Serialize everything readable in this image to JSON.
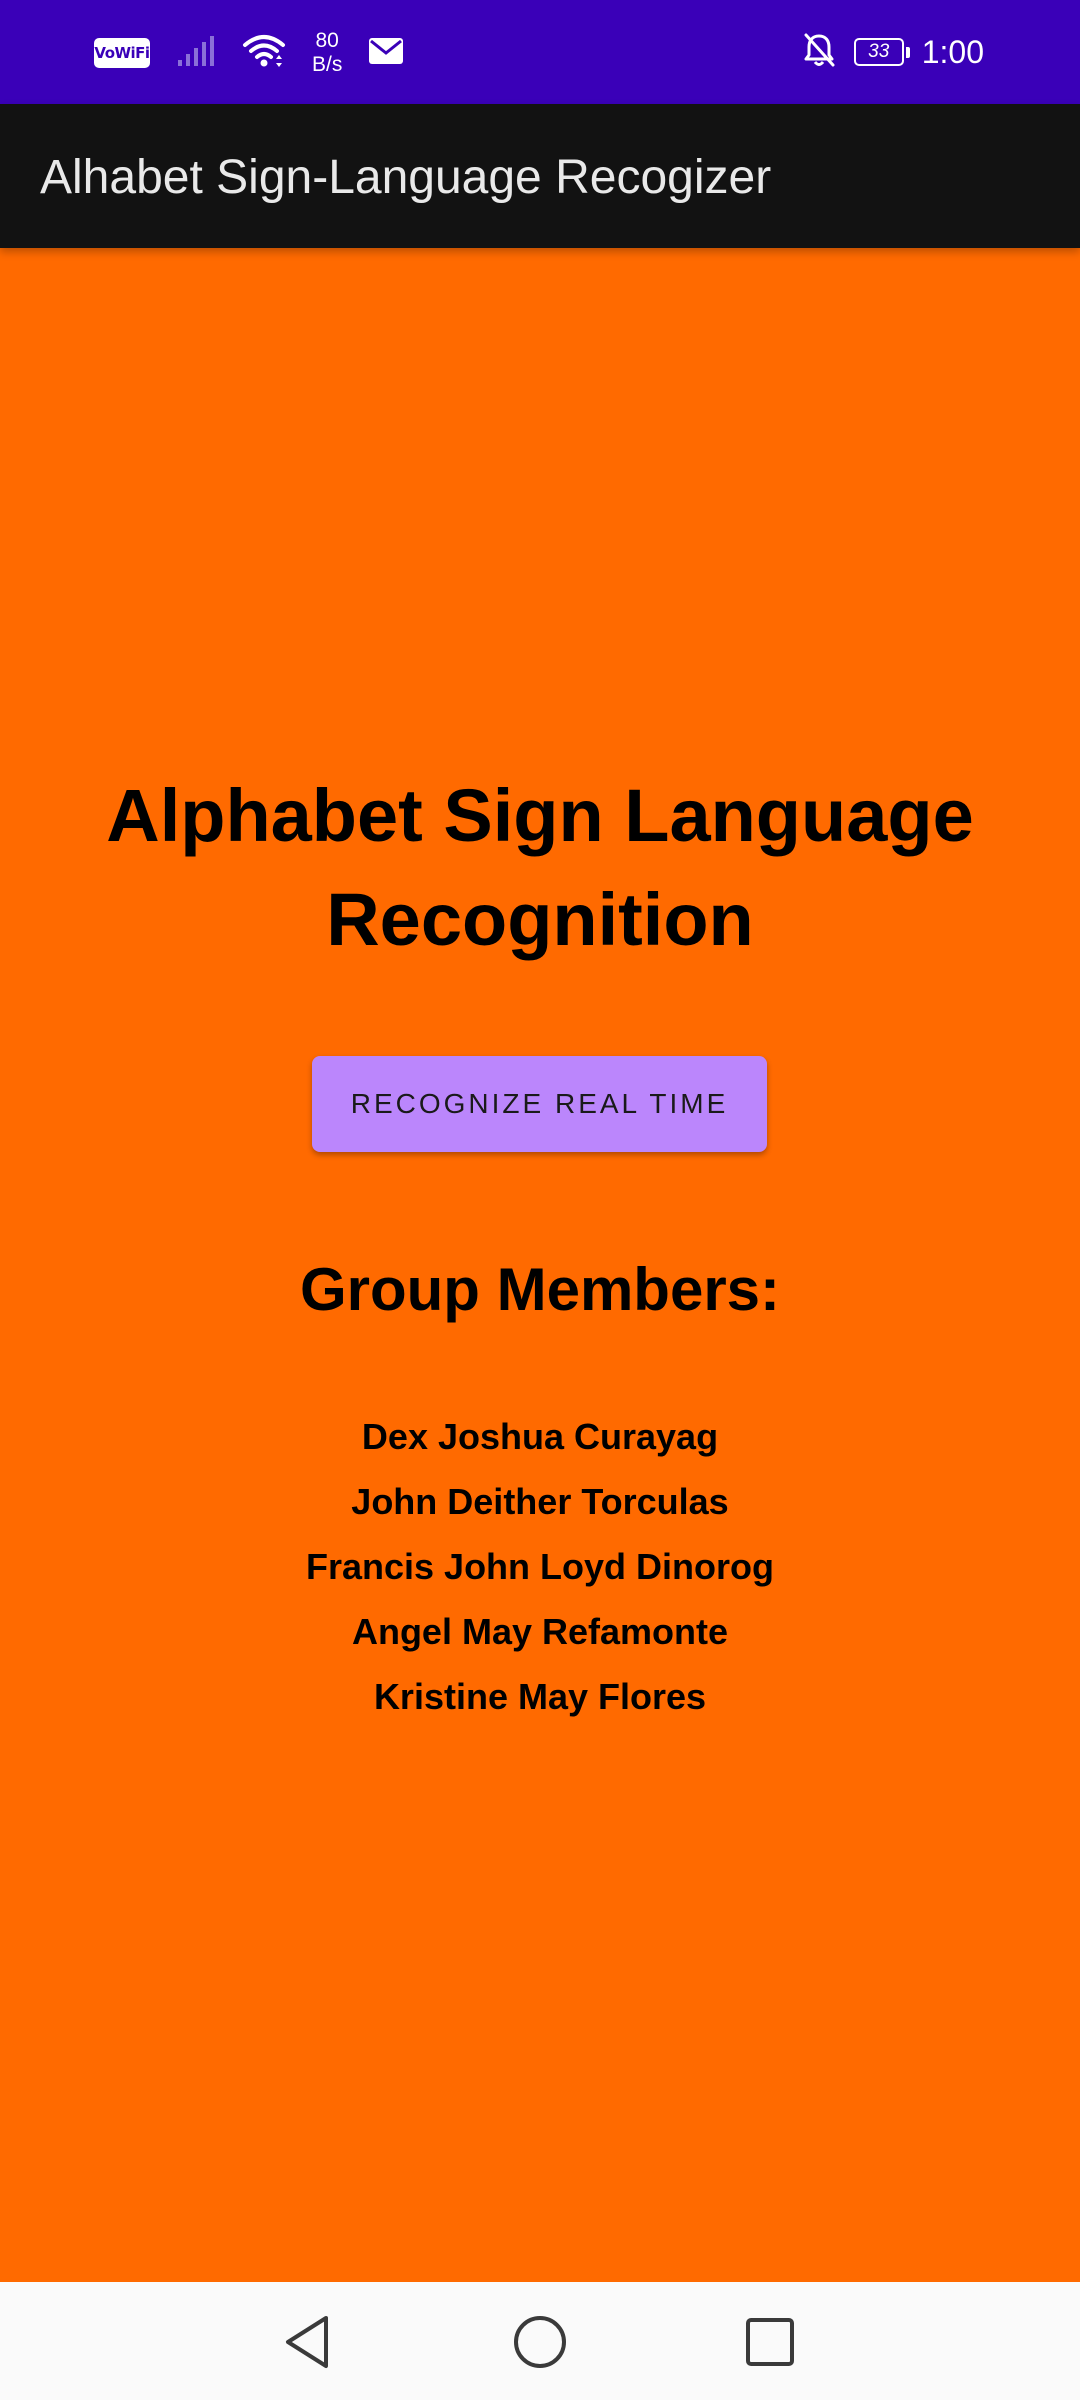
{
  "status_bar": {
    "vowifi_label": "VoWiFi",
    "net_speed_value": "80",
    "net_speed_unit": "B/s",
    "battery_level": "33",
    "time": "1:00",
    "icons": [
      "vowifi-icon",
      "signal-icon",
      "wifi-icon",
      "mail-icon",
      "bell-off-icon",
      "battery-icon"
    ]
  },
  "app_bar": {
    "title": "Alhabet Sign-Language Recogizer"
  },
  "main": {
    "heading": "Alphabet Sign Language Recognition",
    "recognize_button_label": "RECOGNIZE REAL TIME",
    "members_heading": "Group Members:",
    "members": [
      "Dex Joshua Curayag",
      "John Deither Torculas",
      "Francis John Loyd Dinorog",
      "Angel May Refamonte",
      "Kristine May Flores"
    ]
  },
  "nav_bar": {
    "icons": [
      "back-icon",
      "home-icon",
      "recents-icon"
    ]
  },
  "colors": {
    "status_bar": "#3a00b8",
    "app_bar": "#121212",
    "background": "#ff6a00",
    "button": "#bb86fc",
    "nav_bar": "#fafafa"
  }
}
